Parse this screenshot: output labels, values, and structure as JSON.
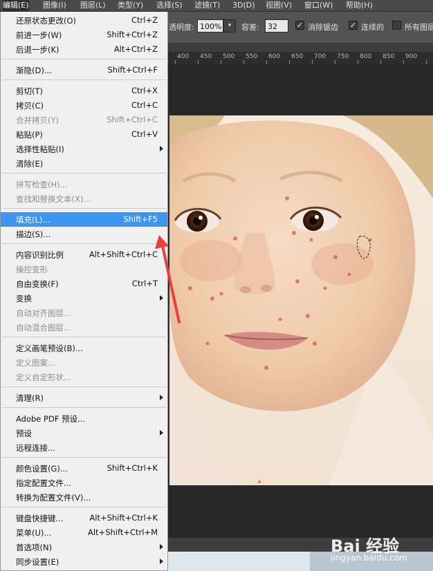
{
  "menubar": {
    "items": [
      {
        "label": "编辑(E)"
      },
      {
        "label": "图像(I)"
      },
      {
        "label": "图层(L)"
      },
      {
        "label": "类型(Y)"
      },
      {
        "label": "选择(S)"
      },
      {
        "label": "滤镜(T)"
      },
      {
        "label": "3D(D)"
      },
      {
        "label": "视图(V)"
      },
      {
        "label": "窗口(W)"
      },
      {
        "label": "帮助(H)"
      }
    ]
  },
  "options_bar": {
    "opacity_label": "透明度:",
    "opacity_value": "100%",
    "tolerance_label": "容差:",
    "tolerance_value": "32",
    "antialias_label": "消除锯齿",
    "contiguous_label": "连续的",
    "all_layers_label": "所有图层"
  },
  "ruler": {
    "ticks": [
      "400",
      "450",
      "500",
      "550",
      "600",
      "650",
      "700",
      "750",
      "800",
      "850",
      "900"
    ]
  },
  "edit_menu": {
    "items": [
      {
        "label": "还原状态更改(O)",
        "shortcut": "Ctrl+Z"
      },
      {
        "label": "前进一步(W)",
        "shortcut": "Shift+Ctrl+Z"
      },
      {
        "label": "后退一步(K)",
        "shortcut": "Alt+Ctrl+Z"
      },
      {
        "label": "渐隐(D)...",
        "shortcut": "Shift+Ctrl+F"
      },
      {
        "label": "剪切(T)",
        "shortcut": "Ctrl+X"
      },
      {
        "label": "拷贝(C)",
        "shortcut": "Ctrl+C"
      },
      {
        "label": "合并拷贝(Y)",
        "shortcut": "Shift+Ctrl+C"
      },
      {
        "label": "粘贴(P)",
        "shortcut": "Ctrl+V"
      },
      {
        "label": "选择性粘贴(I)",
        "shortcut": ""
      },
      {
        "label": "清除(E)",
        "shortcut": ""
      },
      {
        "label": "拼写检查(H)...",
        "shortcut": ""
      },
      {
        "label": "查找和替换文本(X)...",
        "shortcut": ""
      },
      {
        "label": "填充(L)...",
        "shortcut": "Shift+F5"
      },
      {
        "label": "描边(S)...",
        "shortcut": ""
      },
      {
        "label": "内容识别比例",
        "shortcut": "Alt+Shift+Ctrl+C"
      },
      {
        "label": "操控变形",
        "shortcut": ""
      },
      {
        "label": "自由变换(F)",
        "shortcut": "Ctrl+T"
      },
      {
        "label": "变换",
        "shortcut": ""
      },
      {
        "label": "自动对齐图层...",
        "shortcut": ""
      },
      {
        "label": "自动混合图层...",
        "shortcut": ""
      },
      {
        "label": "定义画笔预设(B)...",
        "shortcut": ""
      },
      {
        "label": "定义图案...",
        "shortcut": ""
      },
      {
        "label": "定义自定形状...",
        "shortcut": ""
      },
      {
        "label": "清理(R)",
        "shortcut": ""
      },
      {
        "label": "Adobe PDF 预设...",
        "shortcut": ""
      },
      {
        "label": "预设",
        "shortcut": ""
      },
      {
        "label": "远程连接...",
        "shortcut": ""
      },
      {
        "label": "颜色设置(G)...",
        "shortcut": "Shift+Ctrl+K"
      },
      {
        "label": "指定配置文件...",
        "shortcut": ""
      },
      {
        "label": "转换为配置文件(V)...",
        "shortcut": ""
      },
      {
        "label": "键盘快捷键...",
        "shortcut": "Alt+Shift+Ctrl+K"
      },
      {
        "label": "菜单(U)...",
        "shortcut": "Alt+Shift+Ctrl+M"
      },
      {
        "label": "首选项(N)",
        "shortcut": ""
      },
      {
        "label": "同步设置(E)",
        "shortcut": ""
      }
    ]
  },
  "watermark": {
    "brand": "Bai 经验",
    "url": "jingyan.baidu.com"
  },
  "colors": {
    "highlight": "#3d95f0",
    "arrow": "#e8413c"
  }
}
